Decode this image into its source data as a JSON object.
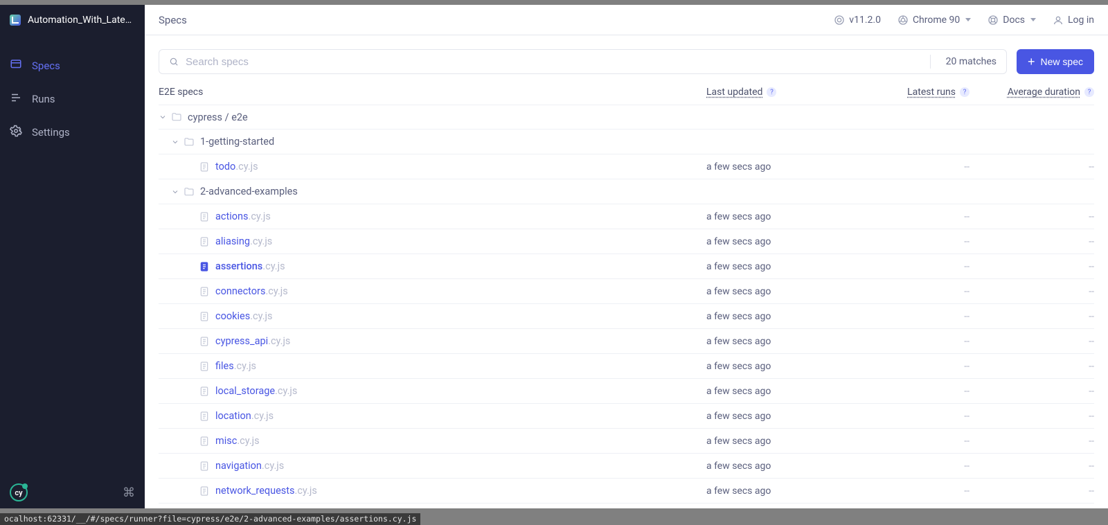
{
  "sidebar": {
    "project_name": "Automation_With_Late…",
    "nav": [
      {
        "label": "Specs",
        "active": true,
        "icon": "specs"
      },
      {
        "label": "Runs",
        "active": false,
        "icon": "runs"
      },
      {
        "label": "Settings",
        "active": false,
        "icon": "settings"
      }
    ],
    "footer_badge": "cy"
  },
  "topbar": {
    "title": "Specs",
    "version": "v11.2.0",
    "browser": "Chrome 90",
    "docs": "Docs",
    "login": "Log in"
  },
  "toolbar": {
    "search_placeholder": "Search specs",
    "matches": "20 matches",
    "new_spec_label": "New spec"
  },
  "columns": {
    "name": "E2E specs",
    "updated": "Last updated",
    "runs": "Latest runs",
    "duration": "Average duration"
  },
  "tree": [
    {
      "type": "folder",
      "label": "cypress / e2e",
      "indent": 0
    },
    {
      "type": "folder",
      "label": "1-getting-started",
      "indent": 1
    },
    {
      "type": "spec",
      "name": "todo",
      "ext": ".cy.js",
      "indent": 2,
      "updated": "a few secs ago",
      "runs": "--",
      "dur": "--",
      "current": false
    },
    {
      "type": "folder",
      "label": "2-advanced-examples",
      "indent": 1
    },
    {
      "type": "spec",
      "name": "actions",
      "ext": ".cy.js",
      "indent": 2,
      "updated": "a few secs ago",
      "runs": "--",
      "dur": "--",
      "current": false
    },
    {
      "type": "spec",
      "name": "aliasing",
      "ext": ".cy.js",
      "indent": 2,
      "updated": "a few secs ago",
      "runs": "--",
      "dur": "--",
      "current": false
    },
    {
      "type": "spec",
      "name": "assertions",
      "ext": ".cy.js",
      "indent": 2,
      "updated": "a few secs ago",
      "runs": "--",
      "dur": "--",
      "current": true
    },
    {
      "type": "spec",
      "name": "connectors",
      "ext": ".cy.js",
      "indent": 2,
      "updated": "a few secs ago",
      "runs": "--",
      "dur": "--",
      "current": false
    },
    {
      "type": "spec",
      "name": "cookies",
      "ext": ".cy.js",
      "indent": 2,
      "updated": "a few secs ago",
      "runs": "--",
      "dur": "--",
      "current": false
    },
    {
      "type": "spec",
      "name": "cypress_api",
      "ext": ".cy.js",
      "indent": 2,
      "updated": "a few secs ago",
      "runs": "--",
      "dur": "--",
      "current": false
    },
    {
      "type": "spec",
      "name": "files",
      "ext": ".cy.js",
      "indent": 2,
      "updated": "a few secs ago",
      "runs": "--",
      "dur": "--",
      "current": false
    },
    {
      "type": "spec",
      "name": "local_storage",
      "ext": ".cy.js",
      "indent": 2,
      "updated": "a few secs ago",
      "runs": "--",
      "dur": "--",
      "current": false
    },
    {
      "type": "spec",
      "name": "location",
      "ext": ".cy.js",
      "indent": 2,
      "updated": "a few secs ago",
      "runs": "--",
      "dur": "--",
      "current": false
    },
    {
      "type": "spec",
      "name": "misc",
      "ext": ".cy.js",
      "indent": 2,
      "updated": "a few secs ago",
      "runs": "--",
      "dur": "--",
      "current": false
    },
    {
      "type": "spec",
      "name": "navigation",
      "ext": ".cy.js",
      "indent": 2,
      "updated": "a few secs ago",
      "runs": "--",
      "dur": "--",
      "current": false
    },
    {
      "type": "spec",
      "name": "network_requests",
      "ext": ".cy.js",
      "indent": 2,
      "updated": "a few secs ago",
      "runs": "--",
      "dur": "--",
      "current": false
    }
  ],
  "statusbar": "ocalhost:62331/__/#/specs/runner?file=cypress/e2e/2-advanced-examples/assertions.cy.js"
}
